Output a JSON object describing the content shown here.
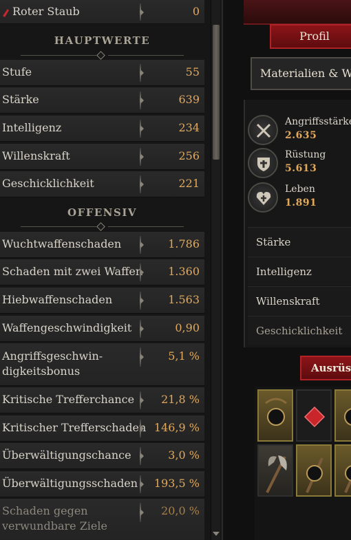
{
  "stats_panel": {
    "top_row": {
      "label": "Roter Staub",
      "value": "0"
    },
    "sections": [
      {
        "title": "HAUPTWERTE",
        "rows": [
          {
            "label": "Stufe",
            "value": "55"
          },
          {
            "label": "Stärke",
            "value": "639"
          },
          {
            "label": "Intelligenz",
            "value": "234"
          },
          {
            "label": "Willenskraft",
            "value": "256"
          },
          {
            "label": "Geschicklichkeit",
            "value": "221"
          }
        ]
      },
      {
        "title": "OFFENSIV",
        "rows": [
          {
            "label": "Wuchtwaffenschaden",
            "value": "1.786"
          },
          {
            "label": "Schaden mit zwei Waffen",
            "value": "1.360"
          },
          {
            "label": "Hiebwaffenschaden",
            "value": "1.563"
          },
          {
            "label": "Waffengeschwindigkeit",
            "value": "0,90"
          },
          {
            "label": "Angriffsgeschwin-",
            "label2": "digkeitsbonus",
            "value": "5,1 %"
          },
          {
            "label": "Kritische Trefferchance",
            "value": "21,8 %"
          },
          {
            "label": "Kritischer Trefferschaden",
            "value": "146,9 %"
          },
          {
            "label": "Überwältigungschance",
            "value": "3,0 %"
          },
          {
            "label": "Überwältigungsschaden",
            "value": "193,5 %"
          },
          {
            "label": "Schaden gegen",
            "label2": "verwundbare Ziele",
            "value": "20,0 %"
          }
        ]
      }
    ]
  },
  "character_panel": {
    "profile_button": "Profil",
    "materials_button": "Materialien & We",
    "summary_stats": [
      {
        "name": "Angriffsstärke",
        "value": "2.635",
        "icon": "crossed-swords-icon"
      },
      {
        "name": "Rüstung",
        "value": "5.613",
        "icon": "shield-icon"
      },
      {
        "name": "Leben",
        "value": "1.891",
        "icon": "heart-icon"
      }
    ],
    "attributes": [
      "Stärke",
      "Intelligenz",
      "Willenskraft",
      "Geschicklichkeit"
    ],
    "equipment_tab": "Ausrüstu"
  },
  "colors": {
    "value_gold": "#e2a95c",
    "button_red": "#8c1418"
  }
}
